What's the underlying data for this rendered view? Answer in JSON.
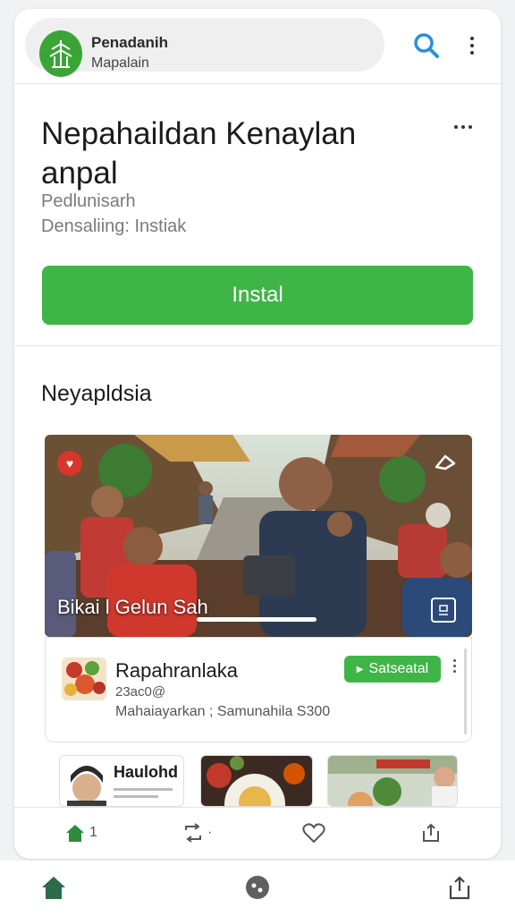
{
  "header": {
    "brand_name": "Penadanih",
    "brand_subtitle": "Mapalain",
    "logo_icon": "temple-icon",
    "search_icon": "search-icon",
    "menu_icon": "more-vertical-icon"
  },
  "app": {
    "title_line1": "Nepahaildan Kenaylan",
    "title_line2": "anpal",
    "developer": "Pedlunisarh",
    "status": "Densaliing: Instiak",
    "install_label": "Instal",
    "more_icon": "more-horizontal-icon"
  },
  "section": {
    "title": "Neyapldsia"
  },
  "hero": {
    "caption": "Bikai l Gelun Sah",
    "progress": 0.28,
    "heart_icon": "heart-icon",
    "share_icon": "share-icon",
    "expand_icon": "expand-icon"
  },
  "listing": {
    "title": "Rapahranlaka",
    "subtitle": "23ac0@",
    "meta": "Mahaiayarkan ; Samunahila S300",
    "button_label": "Satseatal",
    "button_icon": "play-icon"
  },
  "thumbnails": [
    {
      "title": "Haulohd"
    },
    {
      "title": ""
    },
    {
      "title": ""
    }
  ],
  "card_tabs": [
    {
      "icon": "home-icon",
      "label": "1"
    },
    {
      "icon": "repost-icon",
      "label": "·"
    },
    {
      "icon": "heart-outline-icon",
      "label": ""
    },
    {
      "icon": "share-out-icon",
      "label": ""
    }
  ],
  "bottom_nav": [
    {
      "icon": "home-icon"
    },
    {
      "icon": "discover-icon"
    },
    {
      "icon": "share-out-icon"
    }
  ],
  "colors": {
    "accent_green": "#3fb548",
    "search_blue": "#2a90d9",
    "heart_red": "#d9362b"
  }
}
